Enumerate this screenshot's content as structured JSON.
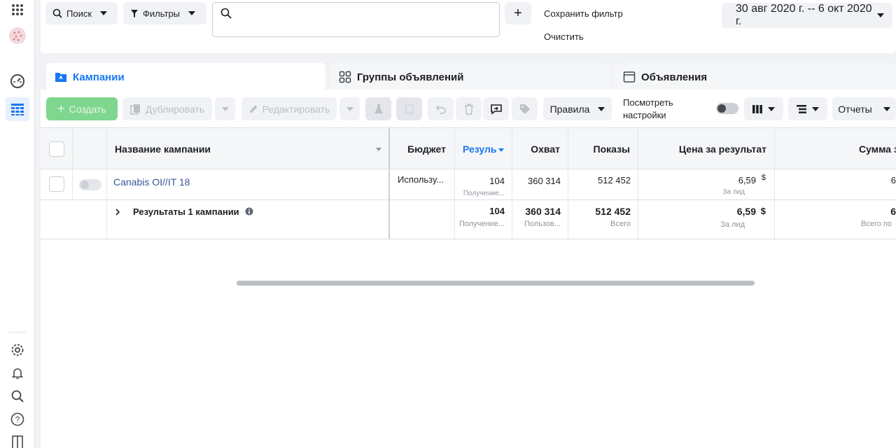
{
  "topbar": {
    "search_label": "Поиск",
    "filters_label": "Фильтры",
    "search_placeholder": "",
    "save_filter": "Сохранить фильтр",
    "clear": "Очистить",
    "date_range": "30 авг 2020 г. -- 6 окт 2020 г."
  },
  "tabs": [
    {
      "label": "Кампании",
      "active": true
    },
    {
      "label": "Группы объявлений",
      "active": false
    },
    {
      "label": "Объявления",
      "active": false
    }
  ],
  "toolbar": {
    "create": "Создать",
    "duplicate": "Дублировать",
    "edit": "Редактировать",
    "rules": "Правила",
    "view_settings": "Посмотреть настройки",
    "reports": "Отчеты"
  },
  "table": {
    "headers": {
      "name": "Название кампании",
      "budget": "Бюджет",
      "results": "Резуль",
      "reach": "Охват",
      "impressions": "Показы",
      "cost_per_result": "Цена за результат",
      "amount": "Сумма з"
    },
    "rows": [
      {
        "name": "Canabis OI//IT 18",
        "budget": "Использу...",
        "results": "104",
        "results_sub": "Получение...",
        "reach": "360 314",
        "impressions": "512 452",
        "cost": "6,59",
        "cost_currency": "$",
        "cost_sub": "За лид",
        "amount": "6"
      }
    ],
    "summary": {
      "label": "Результаты 1 кампании",
      "results": "104",
      "results_sub": "Получение...",
      "reach": "360 314",
      "reach_sub": "Пользов...",
      "impressions": "512 452",
      "impressions_sub": "Всего",
      "cost": "6,59",
      "cost_currency": "$",
      "cost_sub": "За лид",
      "amount": "6",
      "amount_sub": "Всего по"
    }
  },
  "colors": {
    "accent": "#1877f2",
    "create_button": "#7fd68e",
    "link": "#385898"
  }
}
